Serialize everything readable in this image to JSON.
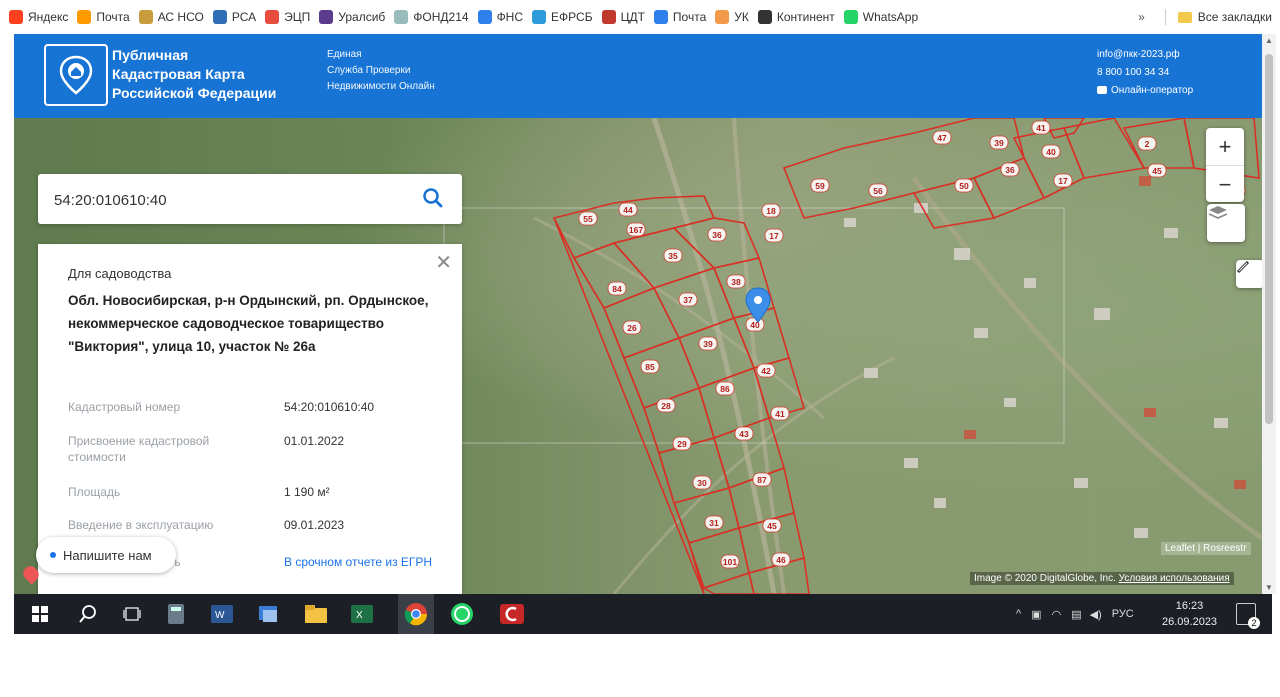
{
  "bookmarks": [
    {
      "label": "Яндекс",
      "color": "#fc3f1d"
    },
    {
      "label": "Почта",
      "color": "#ff9a00"
    },
    {
      "label": "АС НСО",
      "color": "#c89b3c"
    },
    {
      "label": "РСА",
      "color": "#2f6fb5"
    },
    {
      "label": "ЭЦП",
      "color": "#e74c3c"
    },
    {
      "label": "Уралсиб",
      "color": "#5b3b8c"
    },
    {
      "label": "ФОНД214",
      "color": "#9bb"
    },
    {
      "label": "ФНС",
      "color": "#2f80ed"
    },
    {
      "label": "ЕФРСБ",
      "color": "#2d9cdb"
    },
    {
      "label": "ЦДТ",
      "color": "#c0392b"
    },
    {
      "label": "Почта",
      "color": "#2f80ed"
    },
    {
      "label": "УК",
      "color": "#f2994a"
    },
    {
      "label": "Континент",
      "color": "#333333"
    },
    {
      "label": "WhatsApp",
      "color": "#25d366"
    }
  ],
  "bookmarks_more": "»",
  "all_bookmarks": "Все закладки",
  "header": {
    "title_lines": [
      "Публичная",
      "Кадастровая Карта",
      "Российской Федерации"
    ],
    "subtitle_lines": [
      "Единая",
      "Служба Проверки",
      "Недвижимости Онлайн"
    ],
    "email": "info@пкк-2023.рф",
    "phone": "8 800 100 34 34",
    "operator": "Онлайн-оператор"
  },
  "search": {
    "value": "54:20:010610:40"
  },
  "panel": {
    "type": "Для садоводства",
    "address": "Обл. Новосибирская, р-н Ордынский, рп. Ордынское, некоммерческое садоводческое товарищество \"Виктория\", улица 10, участок № 26а",
    "rows": [
      {
        "label": "Кадастровый номер",
        "value": "54:20:010610:40"
      },
      {
        "label": "Присвоение кадастровой стоимости",
        "value": "01.01.2022"
      },
      {
        "label": "Площадь",
        "value": "1 190 м²"
      },
      {
        "label": "Введение в эксплуатацию",
        "value": "09.01.2023"
      },
      {
        "label": "мость",
        "value": "В срочном отчете из ЕГРН"
      }
    ]
  },
  "chat_button": "Напишите нам",
  "map": {
    "zoom_in": "+",
    "zoom_out": "−",
    "leaflet_attr": "Leaflet | Rosreestr",
    "image_attr": "Image © 2020 DigitalGlobe, Inc.",
    "terms_link": "Условия использования",
    "parcel_labels": [
      "55",
      "44",
      "167",
      "18",
      "36",
      "17",
      "35",
      "38",
      "84",
      "37",
      "40",
      "26",
      "39",
      "85",
      "42",
      "86",
      "28",
      "41",
      "43",
      "29",
      "30",
      "87",
      "31",
      "45",
      "101",
      "46",
      "59",
      "56",
      "50",
      "47",
      "39",
      "41",
      "40",
      "36",
      "17",
      "2",
      "45",
      "33"
    ]
  },
  "taskbar": {
    "lang": "РУС",
    "time": "16:23",
    "date": "26.09.2023",
    "notifications": "2"
  },
  "colors": {
    "header_blue": "#1774d4",
    "parcel_red": "#d93025",
    "taskbar": "#1c1f26"
  }
}
